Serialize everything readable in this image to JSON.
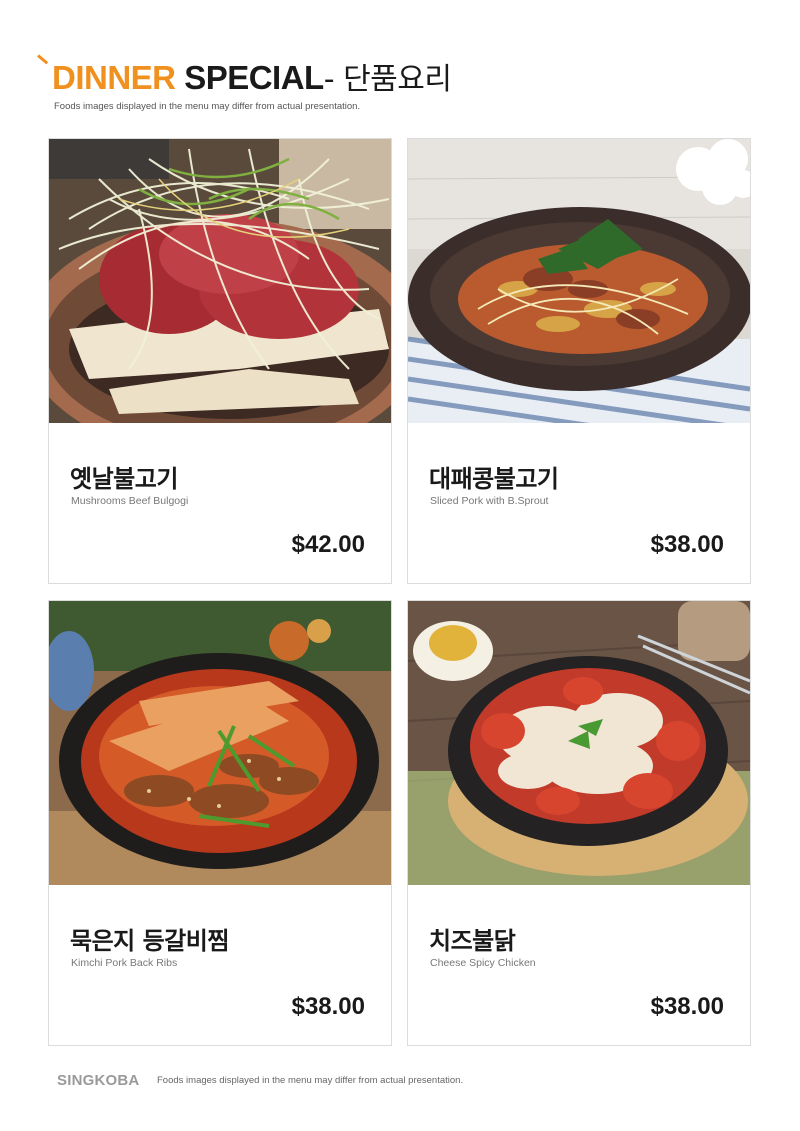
{
  "header": {
    "title_part1": "DINNER",
    "title_part2": "SPECIAL",
    "title_part3": "- 단품요리",
    "subtitle": "Foods images displayed in the menu may differ from actual presentation."
  },
  "menu": [
    {
      "name_kr": "옛날불고기",
      "name_en": "Mushrooms Beef Bulgogi",
      "price": "$42.00"
    },
    {
      "name_kr": "대패콩불고기",
      "name_en": "Sliced Pork with B.Sprout",
      "price": "$38.00"
    },
    {
      "name_kr": "묵은지 등갈비찜",
      "name_en": "Kimchi Pork Back Ribs",
      "price": "$38.00"
    },
    {
      "name_kr": "치즈불닭",
      "name_en": "Cheese Spicy Chicken",
      "price": "$38.00"
    }
  ],
  "footer": {
    "brand": "SINGKOBA",
    "note": "Foods images displayed in the menu may differ from actual presentation."
  },
  "colors": {
    "accent": "#f0901f",
    "text": "#1a1a1a",
    "border": "#dcdcdc"
  }
}
